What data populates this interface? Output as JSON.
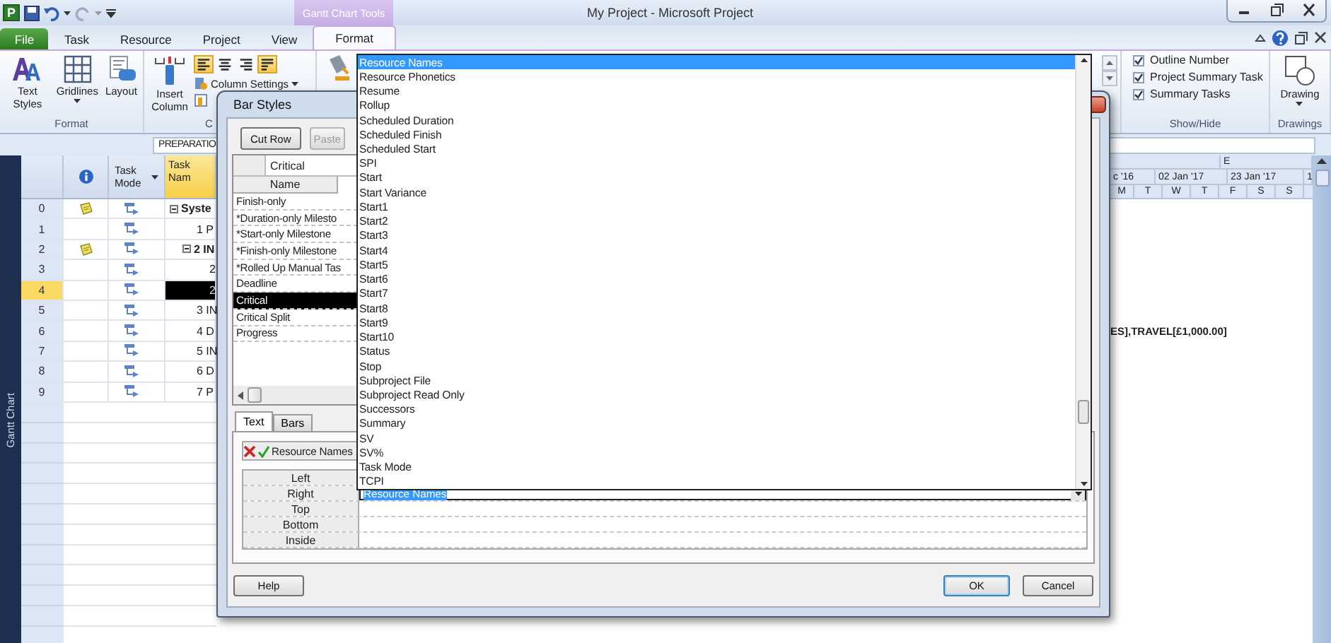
{
  "window": {
    "app_badge": "P",
    "title": "My Project - Microsoft Project",
    "tool_group": "Gantt Chart Tools"
  },
  "tabs": [
    {
      "label": "File",
      "kind": "file",
      "selected": false
    },
    {
      "label": "Task",
      "kind": "plain",
      "selected": false
    },
    {
      "label": "Resource",
      "kind": "plain",
      "selected": false
    },
    {
      "label": "Project",
      "kind": "plain",
      "selected": false
    },
    {
      "label": "View",
      "kind": "plain",
      "selected": false
    },
    {
      "label": "Format",
      "kind": "contextual",
      "selected": true
    }
  ],
  "ribbon": {
    "format_group": {
      "label": "Format",
      "buttons": [
        {
          "label": "Text Styles",
          "kind": "styles",
          "menu": false
        },
        {
          "label": "Gridlines",
          "kind": "grid",
          "menu": true
        },
        {
          "label": "Layout",
          "kind": "layout",
          "menu": false
        }
      ]
    },
    "columns_group": {
      "label": "C",
      "insert_button": "Insert Column",
      "align_buttons": [
        {
          "kind": "left",
          "selected": true
        },
        {
          "kind": "center",
          "selected": false
        },
        {
          "kind": "right",
          "selected": false
        },
        {
          "kind": "wrap",
          "selected": true
        }
      ],
      "settings_button": "Column Settings"
    },
    "show_hide_group": {
      "label": "Show/Hide",
      "checkboxes": [
        {
          "label": "Outline Number",
          "checked": true
        },
        {
          "label": "Project Summary Task",
          "checked": true
        },
        {
          "label": "Summary Tasks",
          "checked": true
        }
      ]
    },
    "drawings_group": {
      "label": "Drawings",
      "button": "Drawing"
    }
  },
  "entry_bar": {
    "value": "PREPARATIO"
  },
  "view_bar": {
    "label": "Gantt Chart"
  },
  "table": {
    "columns": [
      {
        "kind": "info"
      },
      {
        "kind": "mode",
        "label": "Task Mode"
      },
      {
        "kind": "name",
        "label": "Task Nam"
      }
    ],
    "tasks": [
      {
        "id": "0",
        "note": true,
        "name": "Syste",
        "selected": false,
        "children": [
          {
            "id": "1",
            "note": false,
            "name": "1 P",
            "selected": false
          },
          {
            "id": "2",
            "note": true,
            "name": "2 IN",
            "selected": false,
            "children": [
              {
                "id": "3",
                "note": false,
                "name": "2",
                "selected": false
              },
              {
                "id": "4",
                "note": false,
                "name": "2",
                "selected": true
              }
            ]
          },
          {
            "id": "5",
            "note": false,
            "name": "3 IN",
            "selected": false
          },
          {
            "id": "6",
            "note": false,
            "name": "4 D",
            "selected": false,
            "bar_label": "ES],TRAVEL[£1,000.00]"
          },
          {
            "id": "7",
            "note": false,
            "name": "5 IN",
            "selected": false
          },
          {
            "id": "8",
            "note": false,
            "name": "6 D",
            "selected": false
          },
          {
            "id": "9",
            "note": false,
            "name": "7 P",
            "selected": false
          }
        ]
      }
    ]
  },
  "gantt": {
    "timescale_top": [
      "E"
    ],
    "timescale_middle": [
      "c '16",
      "02 Jan '17",
      "23 Jan '17",
      "1"
    ],
    "timescale_bottom": [
      "M",
      "T",
      "W",
      "T",
      "F",
      "S",
      "S"
    ]
  },
  "dialog": {
    "title": "Bar Styles",
    "buttons": [
      {
        "label": "Cut Row",
        "disabled": false
      },
      {
        "label": "Paste",
        "disabled": true
      }
    ],
    "edit_value": "Critical",
    "name_column": "Name",
    "styles": [
      {
        "name": "Finish-only",
        "selected": false
      },
      {
        "name": "*Duration-only Milesto",
        "selected": false
      },
      {
        "name": "*Start-only Milestone",
        "selected": false
      },
      {
        "name": "*Finish-only Milestone",
        "selected": false
      },
      {
        "name": "*Rolled Up Manual Tas",
        "selected": false
      },
      {
        "name": "Deadline",
        "selected": false
      },
      {
        "name": "Critical",
        "selected": true
      },
      {
        "name": "Critical Split",
        "selected": false
      },
      {
        "name": "Progress",
        "selected": false
      }
    ],
    "tabs": [
      {
        "label": "Text",
        "selected": true
      },
      {
        "label": "Bars",
        "selected": false
      }
    ],
    "text_edit_value": "Resource Names",
    "text_rows": [
      {
        "label": "Left"
      },
      {
        "label": "Right",
        "value": "Resource Names"
      },
      {
        "label": "Top"
      },
      {
        "label": "Bottom"
      },
      {
        "label": "Inside"
      }
    ],
    "help_button": "Help",
    "ok_button": "OK",
    "cancel_button": "Cancel"
  },
  "dropdown": {
    "items": [
      {
        "label": "Resource Names",
        "selected": true
      },
      {
        "label": "Resource Phonetics",
        "selected": false
      },
      {
        "label": "Resume",
        "selected": false
      },
      {
        "label": "Rollup",
        "selected": false
      },
      {
        "label": "Scheduled Duration",
        "selected": false
      },
      {
        "label": "Scheduled Finish",
        "selected": false
      },
      {
        "label": "Scheduled Start",
        "selected": false
      },
      {
        "label": "SPI",
        "selected": false
      },
      {
        "label": "Start",
        "selected": false
      },
      {
        "label": "Start Variance",
        "selected": false
      },
      {
        "label": "Start1",
        "selected": false
      },
      {
        "label": "Start2",
        "selected": false
      },
      {
        "label": "Start3",
        "selected": false
      },
      {
        "label": "Start4",
        "selected": false
      },
      {
        "label": "Start5",
        "selected": false
      },
      {
        "label": "Start6",
        "selected": false
      },
      {
        "label": "Start7",
        "selected": false
      },
      {
        "label": "Start8",
        "selected": false
      },
      {
        "label": "Start9",
        "selected": false
      },
      {
        "label": "Start10",
        "selected": false
      },
      {
        "label": "Status",
        "selected": false
      },
      {
        "label": "Stop",
        "selected": false
      },
      {
        "label": "Subproject File",
        "selected": false
      },
      {
        "label": "Subproject Read Only",
        "selected": false
      },
      {
        "label": "Successors",
        "selected": false
      },
      {
        "label": "Summary",
        "selected": false
      },
      {
        "label": "SV",
        "selected": false
      },
      {
        "label": "SV%",
        "selected": false
      },
      {
        "label": "Task Mode",
        "selected": false
      },
      {
        "label": "TCPI",
        "selected": false
      }
    ]
  }
}
